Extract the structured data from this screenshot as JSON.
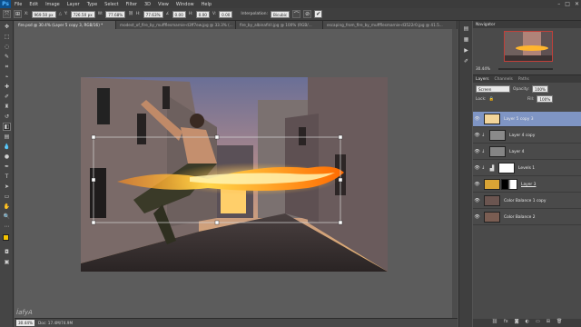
{
  "menubar": {
    "logo": "Ps",
    "items": [
      "File",
      "Edit",
      "Image",
      "Layer",
      "Type",
      "Select",
      "Filter",
      "3D",
      "View",
      "Window",
      "Help"
    ],
    "window_buttons": [
      "–",
      "□",
      "✕"
    ]
  },
  "options": {
    "x": "969.50 px",
    "y": "726.50 px",
    "w": "77.68%",
    "h": "77.63%",
    "angle": "0.00",
    "h_skew": "0.00",
    "v_skew": "0.00",
    "interpolation_label": "Interpolation:",
    "interpolation_value": "Bicubic"
  },
  "tabs": [
    "fire.psd @ 30.4% (Layer 5 copy 3, RGB/16) *",
    "modest_of_fire_by_muffflesmarnie-d3ff7ew.jpg @ 33.3% (...",
    "fire_by_albinafiril.jpg @ 100% (RGB/...",
    "escaping_from_fire_by_muffflesmarnie-d3522r0.jpg @ 41.5..."
  ],
  "status": {
    "zoom": "30.44%",
    "doc": "Doc: 17.4M/74.9M",
    "watermark": "ÍafyA"
  },
  "navigator": {
    "title": "Navigator"
  },
  "layers_panel": {
    "tabs": [
      "Layers",
      "Channels",
      "Paths"
    ],
    "kind": "Screen",
    "opacity_label": "Opacity:",
    "opacity": "100%",
    "fill_label": "Fill:",
    "fill": "100%",
    "lock_label": "Lock:",
    "layers": [
      {
        "name": "Layer 5 copy 3",
        "selected": true
      },
      {
        "name": "Layer 4 copy",
        "selected": false
      },
      {
        "name": "Layer 4",
        "selected": false
      },
      {
        "name": "Levels 1",
        "selected": false
      },
      {
        "name": "Layer 3",
        "selected": false
      },
      {
        "name": "Color Balance 1 copy",
        "selected": false
      },
      {
        "name": "Color Balance 2",
        "selected": false
      }
    ]
  },
  "colors": {
    "accent_selected": "#7f95c4",
    "foreground": "#f5c400",
    "background": "#111111"
  }
}
